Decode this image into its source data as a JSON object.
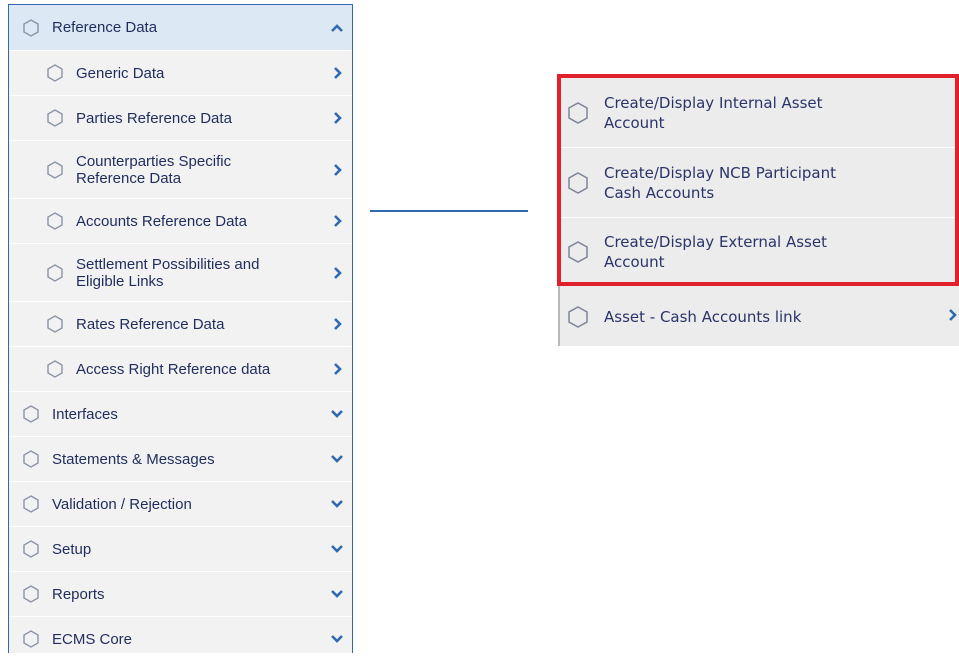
{
  "sidebar": {
    "section": {
      "label": "Reference Data",
      "state": "expanded"
    },
    "sub_items": [
      {
        "label": "Generic Data"
      },
      {
        "label": "Parties Reference Data"
      },
      {
        "label": "Counterparties Specific\nReference Data"
      },
      {
        "label": "Accounts Reference Data"
      },
      {
        "label": "Settlement Possibilities and\nEligible Links"
      },
      {
        "label": "Rates Reference Data"
      },
      {
        "label": "Access Right Reference data"
      }
    ],
    "collapsed_sections": [
      {
        "label": "Interfaces"
      },
      {
        "label": "Statements & Messages"
      },
      {
        "label": "Validation / Rejection"
      },
      {
        "label": "Setup"
      },
      {
        "label": "Reports"
      },
      {
        "label": "ECMS Core"
      }
    ]
  },
  "submenu": {
    "items": [
      {
        "label": "Create/Display Internal Asset\nAccount",
        "highlighted": true
      },
      {
        "label": "Create/Display NCB Participant\nCash Accounts",
        "highlighted": true
      },
      {
        "label": "Create/Display External Asset\nAccount",
        "highlighted": true
      },
      {
        "label": "Asset - Cash Accounts link",
        "highlighted": false
      }
    ]
  },
  "colors": {
    "accent": "#2f6ab0",
    "header_bg": "#dde8f5",
    "highlight_border": "#e0202b",
    "text": "#1f2d5c"
  },
  "icons": {
    "item": "hexagon-outline-icon",
    "expanded": "chevron-up-icon",
    "submenu": "chevron-right-icon",
    "collapsed": "chevron-down-icon"
  }
}
